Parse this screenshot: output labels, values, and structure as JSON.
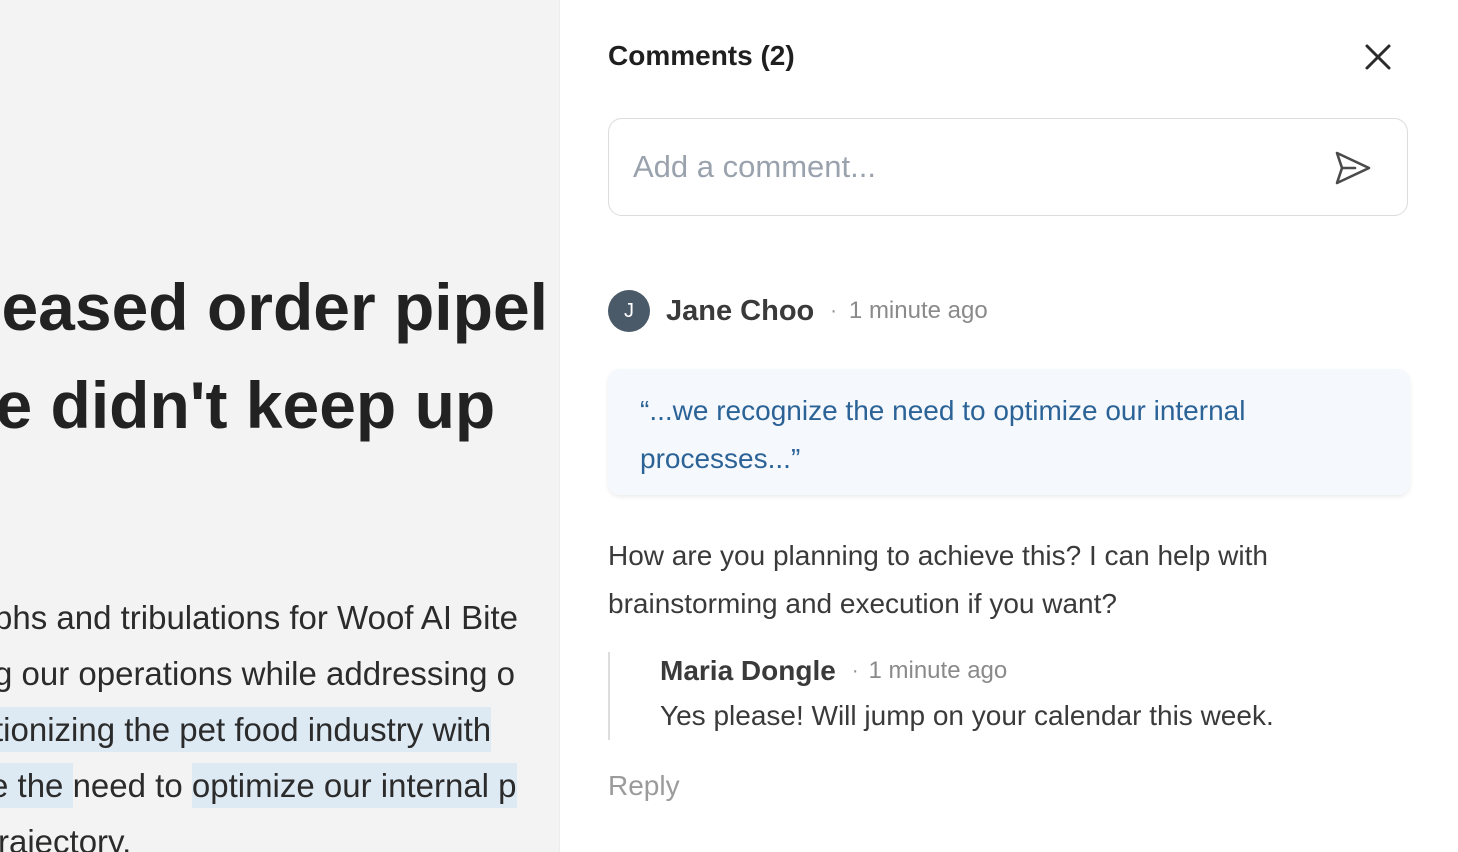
{
  "document": {
    "title_lines": [
      "eased order pipel",
      "e didn't keep up"
    ],
    "body_lines": [
      [
        "phs and tribulations for Woof AI Bite"
      ],
      [
        "g our operations while addressing o"
      ],
      [
        "tionizing the pet food industry with "
      ],
      [
        "e the ",
        "need to ",
        "optimize our internal p"
      ],
      [
        "rajectory."
      ]
    ]
  },
  "panel": {
    "title": "Comments (2)",
    "close_icon": "close-icon",
    "input": {
      "placeholder": "Add a comment...",
      "value": ""
    },
    "send_icon": "send-icon"
  },
  "thread": {
    "author": {
      "initial": "J",
      "name": "Jane Choo",
      "separator": "·",
      "time": "1 minute ago"
    },
    "quote": "“...we recognize the need to optimize our internal processes...”",
    "text": "How are you planning to achieve this? I can help with brainstorming and execution if you want?",
    "reply": {
      "name": "Maria Dongle",
      "separator": "·",
      "time": "1 minute ago",
      "text": "Yes please! Will jump on your calendar this week."
    },
    "reply_label": "Reply"
  },
  "colors": {
    "accent_quote": "#2c6397",
    "avatar_bg": "#4a5a69",
    "highlight": "#dde9f3"
  }
}
